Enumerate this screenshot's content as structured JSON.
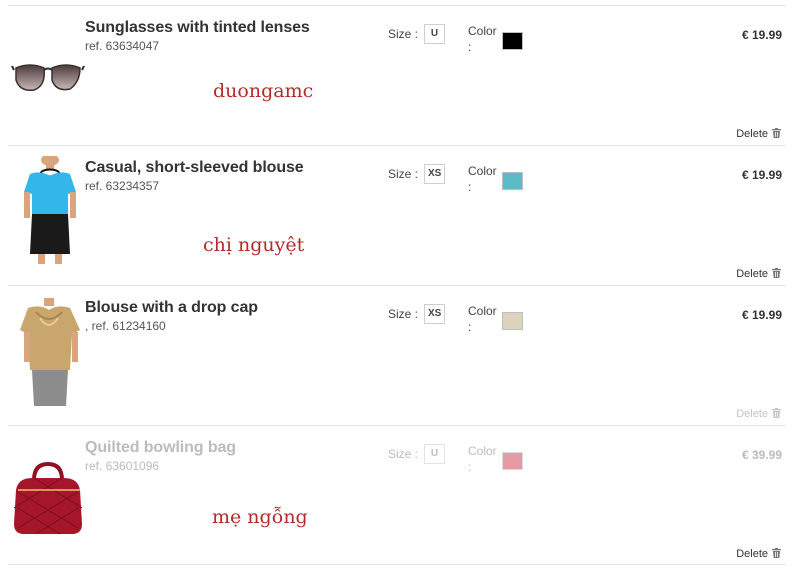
{
  "items": [
    {
      "title": "Sunglasses with tinted lenses",
      "ref": "ref. 63634047",
      "size_label": "Size :",
      "size": "U",
      "color_label": "Color :",
      "color": "#000000",
      "price": "€ 19.99",
      "delete_label": "Delete",
      "annotation": "duongamc",
      "image_icon": "sunglasses-image"
    },
    {
      "title": "Casual, short-sleeved blouse",
      "ref": "ref. 63234357",
      "size_label": "Size :",
      "size": "XS",
      "color_label": "Color :",
      "color": "#5bbcc6",
      "price": "€ 19.99",
      "delete_label": "Delete",
      "annotation": "chị nguyệt",
      "image_icon": "blue-blouse-image"
    },
    {
      "title": "Blouse with a drop cap",
      "ref": ", ref. 61234160",
      "size_label": "Size :",
      "size": "XS",
      "color_label": "Color :",
      "color": "#dcd3bd",
      "price": "€ 19.99",
      "delete_label": "Delete",
      "annotation": "",
      "image_icon": "gold-blouse-image"
    },
    {
      "title": "Quilted bowling bag",
      "ref": "ref. 63601096",
      "size_label": "Size :",
      "size": "U",
      "color_label": "Color :",
      "color": "#e59aa6",
      "price": "€ 39.99",
      "delete_label": "Delete",
      "annotation": "mẹ ngỗng",
      "image_icon": "red-bag-image"
    }
  ]
}
